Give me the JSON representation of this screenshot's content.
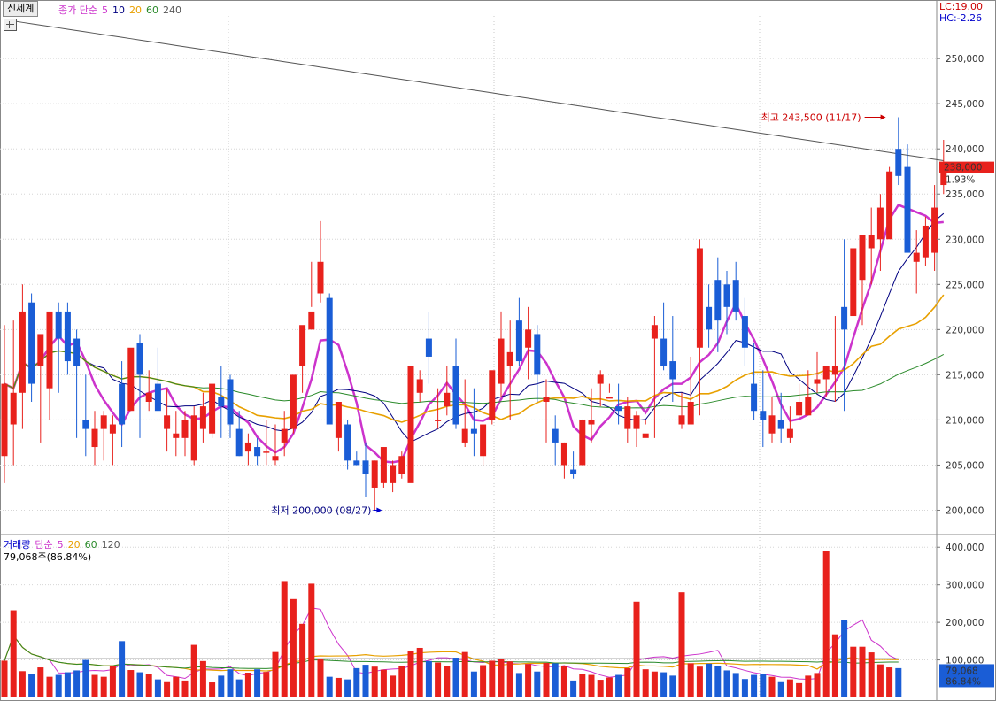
{
  "price_pane": {
    "stock_button": "신세계",
    "legend": [
      {
        "text": "종가 단순",
        "color": "#cc33cc"
      },
      {
        "text": "5",
        "color": "#cc33cc"
      },
      {
        "text": "10",
        "color": "#000080"
      },
      {
        "text": "20",
        "color": "#e8a000"
      },
      {
        "text": "60",
        "color": "#2a8a2a"
      },
      {
        "text": "240",
        "color": "#555555"
      }
    ],
    "lc_label": "LC:19.00",
    "hc_label": "HC:-2.26",
    "current_price_tag": "238,000",
    "change_pct": "1.93%",
    "high_annotation": "최고 243,500 (11/17)",
    "low_annotation": "최저 200,000 (08/27)"
  },
  "volume_pane": {
    "legend": [
      {
        "text": "거래량",
        "color": "#0000cc"
      },
      {
        "text": "단순",
        "color": "#cc33cc"
      },
      {
        "text": "5",
        "color": "#cc33cc"
      },
      {
        "text": "20",
        "color": "#e8a000"
      },
      {
        "text": "60",
        "color": "#2a8a2a"
      },
      {
        "text": "120",
        "color": "#555555"
      }
    ],
    "summary": "79,068주(86.84%)",
    "current_volume_tag": "79,068",
    "current_pct_tag": "86.84%"
  },
  "chart_data": {
    "type": "candlestick",
    "up_color": "#e8211c",
    "down_color": "#1a5dd6",
    "price_ticks": [
      "250,000",
      "245,000",
      "240,000",
      "235,000",
      "230,000",
      "225,000",
      "220,000",
      "215,000",
      "210,000",
      "205,000",
      "200,000"
    ],
    "price_tick_values": [
      250000,
      245000,
      240000,
      235000,
      230000,
      225000,
      220000,
      215000,
      210000,
      205000,
      200000
    ],
    "price_range": [
      197500,
      255500
    ],
    "volume_ticks": [
      "400,000",
      "300,000",
      "200,000",
      "100,000"
    ],
    "volume_tick_values": [
      400000,
      300000,
      200000,
      100000
    ],
    "volume_range": [
      0,
      410000
    ],
    "candles": [
      [
        206000,
        220500,
        203000,
        214000
      ],
      [
        209500,
        221000,
        205000,
        213000
      ],
      [
        213000,
        225000,
        209000,
        222000
      ],
      [
        223000,
        224000,
        212000,
        214000
      ],
      [
        216000,
        217000,
        207500,
        219500
      ],
      [
        213500,
        216000,
        210000,
        222000
      ],
      [
        222000,
        223000,
        213000,
        219000
      ],
      [
        222000,
        223000,
        215000,
        216500
      ],
      [
        219000,
        220000,
        208000,
        216000
      ],
      [
        210000,
        215000,
        206000,
        209000
      ],
      [
        207000,
        211000,
        205000,
        209000
      ],
      [
        209000,
        211000,
        205500,
        210500
      ],
      [
        208500,
        210500,
        205000,
        209500
      ],
      [
        214000,
        216500,
        207000,
        209500
      ],
      [
        211000,
        215500,
        211000,
        218000
      ],
      [
        218500,
        219500,
        208000,
        215000
      ],
      [
        212000,
        215500,
        211000,
        213000
      ],
      [
        214000,
        218000,
        211000,
        211000
      ],
      [
        209000,
        213500,
        206500,
        210500
      ],
      [
        208000,
        211000,
        206000,
        208500
      ],
      [
        208000,
        211000,
        206000,
        210000
      ],
      [
        205500,
        211500,
        205000,
        210500
      ],
      [
        209000,
        213000,
        207500,
        211500
      ],
      [
        208500,
        212500,
        208000,
        214000
      ],
      [
        212500,
        216000,
        208000,
        211500
      ],
      [
        214500,
        215000,
        208000,
        209500
      ],
      [
        209000,
        211000,
        206000,
        206000
      ],
      [
        206500,
        208500,
        205000,
        207500
      ],
      [
        207000,
        208000,
        205000,
        206000
      ],
      [
        206500,
        210000,
        205000,
        206500
      ],
      [
        205500,
        209500,
        205000,
        206000
      ],
      [
        207500,
        211000,
        206000,
        209000
      ],
      [
        209000,
        214000,
        208500,
        215000
      ],
      [
        216000,
        220000,
        213000,
        220500
      ],
      [
        220000,
        227500,
        222500,
        222000
      ],
      [
        224000,
        232000,
        223000,
        227500
      ],
      [
        223500,
        224000,
        210000,
        209500
      ],
      [
        208000,
        212000,
        206500,
        212000
      ],
      [
        209500,
        210000,
        204500,
        205500
      ],
      [
        205500,
        206500,
        205000,
        205000
      ],
      [
        205500,
        207500,
        201500,
        204000
      ],
      [
        202500,
        205500,
        200000,
        205500
      ],
      [
        203000,
        206000,
        202500,
        207000
      ],
      [
        203000,
        205500,
        202000,
        205000
      ],
      [
        204000,
        206500,
        203500,
        206000
      ],
      [
        203000,
        213500,
        204000,
        216000
      ],
      [
        213000,
        215500,
        212000,
        214500
      ],
      [
        219000,
        222000,
        214000,
        217000
      ],
      [
        210000,
        213500,
        209000,
        210000
      ],
      [
        211500,
        216000,
        210500,
        213000
      ],
      [
        216000,
        219000,
        209000,
        209500
      ],
      [
        207500,
        214500,
        207000,
        209000
      ],
      [
        209000,
        213500,
        206000,
        208500
      ],
      [
        206000,
        207000,
        205000,
        209500
      ],
      [
        210000,
        211500,
        209500,
        215500
      ],
      [
        214000,
        222000,
        212500,
        219000
      ],
      [
        216000,
        221000,
        210000,
        217500
      ],
      [
        221000,
        223500,
        216000,
        216500
      ],
      [
        218000,
        222500,
        214500,
        220000
      ],
      [
        219500,
        220500,
        212000,
        215000
      ],
      [
        212000,
        214500,
        207500,
        212500
      ],
      [
        209000,
        210500,
        205000,
        207500
      ],
      [
        205000,
        207500,
        203500,
        207500
      ],
      [
        204500,
        206500,
        203500,
        204000
      ],
      [
        205000,
        209000,
        205000,
        210000
      ],
      [
        209500,
        213500,
        207500,
        210000
      ],
      [
        214000,
        215500,
        211500,
        215000
      ],
      [
        212500,
        214000,
        213000,
        212500
      ],
      [
        211500,
        214000,
        209500,
        211000
      ],
      [
        209000,
        212500,
        207500,
        211500
      ],
      [
        209000,
        211000,
        207000,
        210500
      ],
      [
        208000,
        209500,
        210000,
        208500
      ],
      [
        219000,
        221500,
        208000,
        220500
      ],
      [
        219000,
        223000,
        215500,
        216000
      ],
      [
        216500,
        221500,
        212000,
        214500
      ],
      [
        209500,
        213000,
        209000,
        210500
      ],
      [
        209500,
        217000,
        212000,
        212000
      ],
      [
        218000,
        230000,
        210500,
        229000
      ],
      [
        222500,
        225000,
        218000,
        220000
      ],
      [
        225500,
        228000,
        217500,
        221000
      ],
      [
        225000,
        226500,
        219500,
        222500
      ],
      [
        225500,
        227500,
        221000,
        222000
      ],
      [
        221500,
        223500,
        216000,
        218000
      ],
      [
        214000,
        218500,
        210000,
        211000
      ],
      [
        211000,
        215500,
        207000,
        210000
      ],
      [
        208500,
        212500,
        207500,
        210500
      ],
      [
        210000,
        213000,
        207500,
        209000
      ],
      [
        208000,
        211500,
        207500,
        209000
      ],
      [
        210500,
        214000,
        210000,
        212000
      ],
      [
        210500,
        215500,
        212000,
        212500
      ],
      [
        214000,
        217500,
        213000,
        214500
      ],
      [
        214500,
        216000,
        212500,
        216000
      ],
      [
        215000,
        221500,
        212000,
        216000
      ],
      [
        222500,
        230000,
        211000,
        220000
      ],
      [
        221500,
        224500,
        223500,
        229000
      ],
      [
        225500,
        226500,
        220500,
        230500
      ],
      [
        229000,
        233500,
        225000,
        230500
      ],
      [
        230000,
        235000,
        226500,
        233500
      ],
      [
        230000,
        238000,
        232500,
        237500
      ],
      [
        240000,
        243500,
        236000,
        237000
      ],
      [
        238000,
        240500,
        231000,
        228500
      ],
      [
        227500,
        231000,
        224000,
        228500
      ],
      [
        228000,
        232500,
        227000,
        231500
      ],
      [
        228500,
        236000,
        226500,
        233500
      ],
      [
        236000,
        241000,
        235000,
        237500
      ]
    ],
    "volumes": [
      98000,
      232000,
      70000,
      62000,
      80000,
      55000,
      60000,
      67000,
      72000,
      100000,
      60000,
      55000,
      84000,
      150000,
      73000,
      67000,
      62000,
      48000,
      43000,
      55000,
      45000,
      140000,
      97000,
      40000,
      58000,
      75000,
      48000,
      66000,
      75000,
      68000,
      121000,
      310000,
      262000,
      196000,
      303000,
      102000,
      55000,
      52000,
      48000,
      78000,
      87000,
      82000,
      74000,
      58000,
      83000,
      123000,
      132000,
      97000,
      93000,
      83000,
      106000,
      121000,
      69000,
      86000,
      98000,
      103000,
      96000,
      65000,
      89000,
      69000,
      92000,
      91000,
      83000,
      45000,
      63000,
      60000,
      47000,
      53000,
      60000,
      78000,
      255000,
      75000,
      69000,
      67000,
      58000,
      280000,
      91000,
      82000,
      90000,
      84000,
      72000,
      65000,
      49000,
      60000,
      62000,
      55000,
      43000,
      48000,
      38000,
      58000,
      65000,
      390000,
      168000,
      205000,
      135000,
      135000,
      120000,
      88000,
      80000,
      78000
    ]
  }
}
